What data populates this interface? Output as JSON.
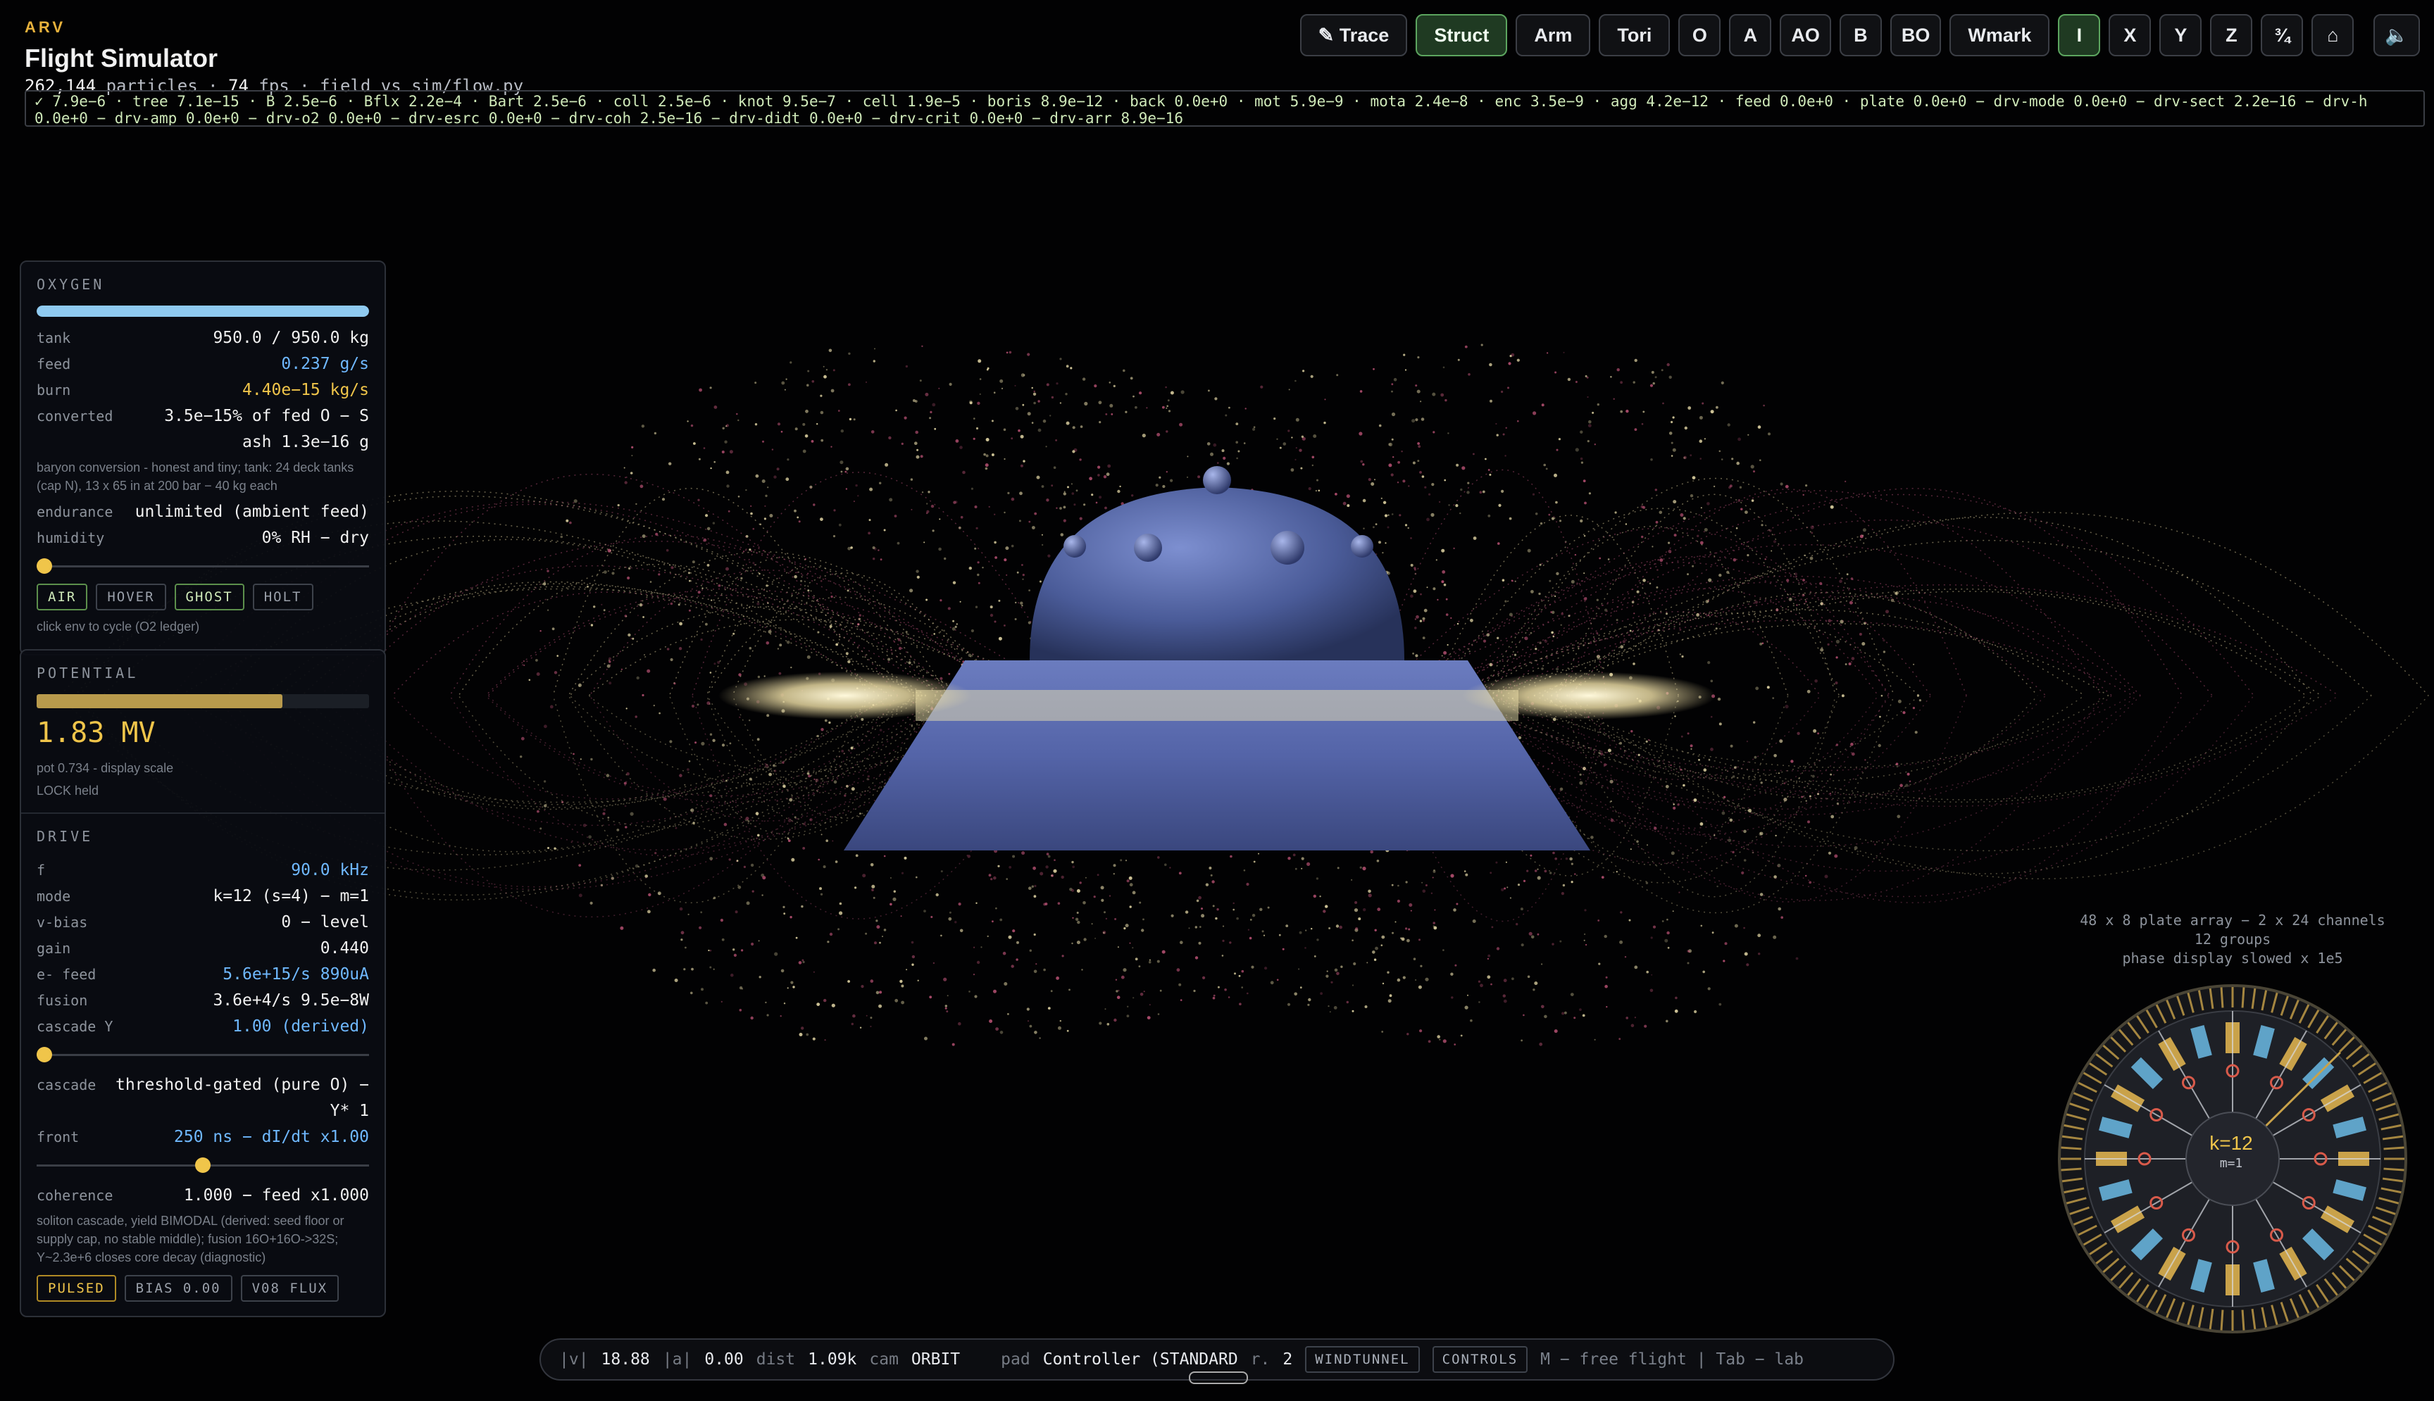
{
  "header": {
    "tag": "ARV",
    "title": "Flight Simulator",
    "particles": "262,144",
    "particles_label": "particles",
    "fps": "74",
    "fps_label": "fps",
    "source": "field vs sim/flow.py"
  },
  "residuals": "✓ 7.9e−6 · tree 7.1e−15 · B 2.5e−6 · Bflx 2.2e−4 · Bart 2.5e−6 · coll 2.5e−6 · knot 9.5e−7 · cell 1.9e−5 · boris 8.9e−12 · back 0.0e+0 · mot 5.9e−9 · mota 2.4e−8 · enc 3.5e−9 · agg 4.2e−12 · feed 0.0e+0 · plate 0.0e+0 − drv-mode 0.0e+0 − drv-sect 2.2e−16 − drv-h 0.0e+0 − drv-amp 0.0e+0 − drv-o2 0.0e+0 − drv-esrc 0.0e+0 − drv-coh 2.5e−16 − drv-didt 0.0e+0 − drv-crit 0.0e+0 − drv-arr 8.9e−16",
  "toolbar": {
    "trace": "✎ Trace",
    "struct": "Struct",
    "arm": "Arm",
    "tori": "Tori",
    "o": "O",
    "a": "A",
    "ao": "AO",
    "b": "B",
    "bo": "BO",
    "wmark": "Wmark",
    "i": "I",
    "x": "X",
    "y": "Y",
    "z": "Z",
    "frac": "¾",
    "home": "⌂",
    "sound": "🔈"
  },
  "oxygen": {
    "title": "OXYGEN",
    "fill_fraction": 1.0,
    "rows": {
      "tank_k": "tank",
      "tank_v": "950.0 / 950.0 kg",
      "feed_k": "feed",
      "feed_v": "0.237 g/s",
      "burn_k": "burn",
      "burn_v": "4.40e−15 kg/s",
      "conv_k": "converted",
      "conv_v": "3.5e−15% of fed O − S",
      "ash_v": "ash 1.3e−16 g"
    },
    "note": "baryon conversion - honest and tiny; tank: 24 deck tanks (cap N), 13 x 65 in at 200 bar − 40 kg each",
    "endurance_k": "endurance",
    "endurance_v": "unlimited (ambient feed)",
    "humidity_k": "humidity",
    "humidity_v": "0% RH − dry",
    "humidity_level": 0.0,
    "chips": [
      "AIR",
      "HOVER",
      "GHOST",
      "HOLT"
    ],
    "hint": "click env to cycle (O2 ledger)"
  },
  "potential": {
    "title": "POTENTIAL",
    "fill_fraction": 0.74,
    "value": "1.83 MV",
    "scale_note": "pot 0.734 - display scale",
    "lock_note": "LOCK held"
  },
  "drive": {
    "title": "DRIVE",
    "f_k": "f",
    "f_v": "90.0 kHz",
    "mode_k": "mode",
    "mode_v": "k=12 (s=4) − m=1",
    "vbias_k": "v-bias",
    "vbias_v": "0 − level",
    "gain_k": "gain",
    "gain_v": "0.440",
    "efeed_k": "e- feed",
    "efeed_v": "5.6e+15/s 890uA",
    "fusion_k": "fusion",
    "fusion_v": "3.6e+4/s 9.5e−8W",
    "cascY_k": "cascade Y",
    "cascY_v": "1.00 (derived)",
    "cascY_level": 0.0,
    "cascade_k": "cascade",
    "cascade_v": "threshold-gated (pure O) −",
    "cascade_v2": "Y* 1",
    "front_k": "front",
    "front_v": "250 ns − dI/dt x1.00",
    "front_level": 0.5,
    "coh_k": "coherence",
    "coh_v": "1.000 − feed x1.000",
    "note": "soliton cascade, yield BIMODAL (derived: seed floor or supply cap, no stable middle); fusion 16O+16O->32S; Y~2.3e+6 closes core decay (diagnostic)",
    "chips": [
      "PULSED",
      "BIAS 0.00",
      "V08 FLUX"
    ]
  },
  "plate_ring": {
    "caption1": "48 x 8 plate array − 2 x 24 channels",
    "caption2": "12 groups",
    "caption3": "phase display slowed x 1e5",
    "k_label": "k=12",
    "m_label": "m=1",
    "colors": {
      "gold": "#c9a24a",
      "blue": "#5fa3c8",
      "red": "#d85a4a"
    }
  },
  "status": {
    "v_label": "|v|",
    "v_value": "18.88",
    "a_label": "|a|",
    "a_value": "0.00",
    "dist_label": "dist",
    "dist_value": "1.09k",
    "cam_label": "cam",
    "cam_value": "ORBIT",
    "pad_label": "pad",
    "pad_value": "Controller (STANDARD",
    "r_label": "r.",
    "r_value": "2",
    "windtunnel": "WINDTUNNEL",
    "controls": "CONTROLS",
    "hint": "M − free flight | Tab − lab"
  },
  "colors": {
    "accent_gold": "#f0c54a",
    "accent_blue": "#6fb8ff",
    "ship": "#5667a8",
    "particles_warm": "#f3e7b3",
    "particles_pink": "#c5577a"
  }
}
